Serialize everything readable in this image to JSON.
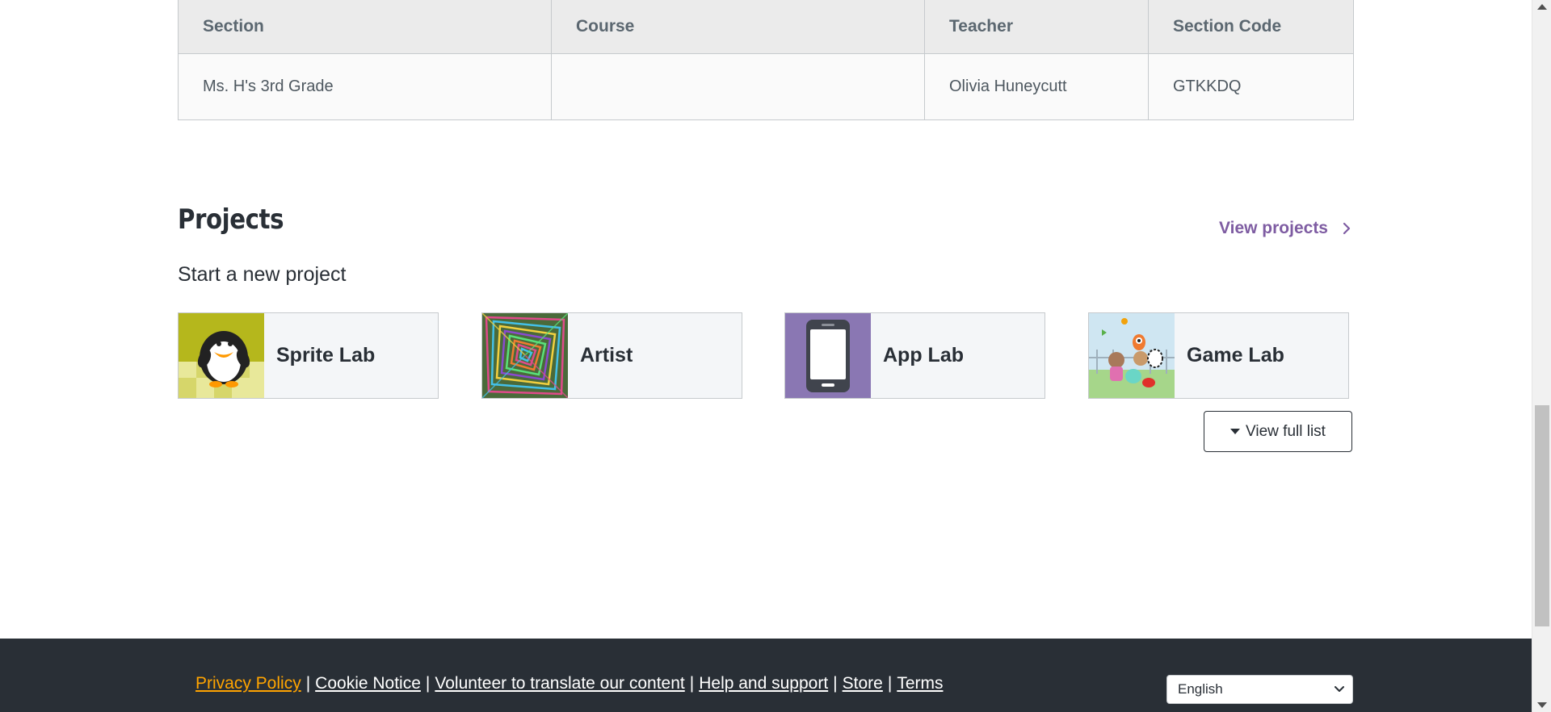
{
  "sections_table": {
    "headers": [
      "Section",
      "Course",
      "Teacher",
      "Section Code"
    ],
    "rows": [
      [
        "Ms. H's 3rd Grade",
        "",
        "Olivia Huneycutt",
        "GTKKDQ"
      ]
    ]
  },
  "projects": {
    "title": "Projects",
    "view_projects_label": "View projects",
    "start_new_label": "Start a new project",
    "tiles": [
      {
        "label": "Sprite Lab",
        "icon": "sprite-lab-thumbnail"
      },
      {
        "label": "Artist",
        "icon": "artist-thumbnail"
      },
      {
        "label": "App Lab",
        "icon": "app-lab-thumbnail"
      },
      {
        "label": "Game Lab",
        "icon": "game-lab-thumbnail"
      }
    ],
    "view_full_list_label": "View full list"
  },
  "footer": {
    "links": [
      "Privacy Policy",
      "Cookie Notice",
      "Volunteer to translate our content",
      "Help and support",
      "Store",
      "Terms"
    ],
    "language_selected": "English"
  },
  "colors": {
    "accent_purple": "#7e5ca2",
    "footer_bg": "#292f36",
    "privacy_link": "#ffa400",
    "tile_bg": "#f4f6f8"
  }
}
